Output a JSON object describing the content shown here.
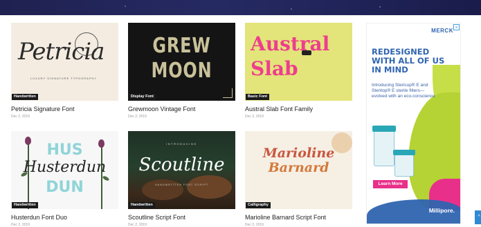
{
  "cards": [
    {
      "title": "Petricia Signature Font",
      "date": "Dec 2, 2019",
      "tag": "Handwritten",
      "preview": {
        "script": "Petricia",
        "sub": "LUXURY SIGNATURE TYPOGRAPHY"
      }
    },
    {
      "title": "Grewmoon Vintage Font",
      "date": "Dec 2, 2019",
      "tag": "Display Font",
      "preview": {
        "line1": "GREW",
        "line2": "MOON"
      }
    },
    {
      "title": "Austral Slab Font Family",
      "date": "Dec 2, 2019",
      "tag": "Basic Font",
      "preview": {
        "line1": "Austral",
        "line2": "Slab"
      }
    },
    {
      "title": "Husterdun Font Duo",
      "date": "Dec 2, 2019",
      "tag": "Handwritten",
      "preview": {
        "top": "HUS",
        "script": "Husterdun",
        "bottom": "DUN"
      }
    },
    {
      "title": "Scoutline Script Font",
      "date": "Dec 2, 2019",
      "tag": "Handwritten",
      "preview": {
        "header": "INTRODUCING",
        "script": "Scoutline",
        "footer": "HANDWRITTEN FONT SCRIPT"
      }
    },
    {
      "title": "Marioline Barnard Script Font",
      "date": "Dec 2, 2019",
      "tag": "Calligraphy",
      "preview": {
        "line1": "Marioline",
        "line2": "Barnard"
      }
    }
  ],
  "ad": {
    "logo": "MERCK",
    "headline": [
      "REDESIGNED",
      "WITH ALL OF US",
      "IN MIND"
    ],
    "body": "Introducing Stericup® E and Steritop® E sterile filters—evolved with an eco-conscience",
    "cta": "Learn More",
    "brand": "Millipore.",
    "close": "×"
  },
  "scroll_top": "^",
  "colors": {
    "header_band": "#1f2150",
    "ad_blue": "#2f64b0",
    "ad_pink": "#e8308a",
    "ad_green": "#b5d334"
  }
}
